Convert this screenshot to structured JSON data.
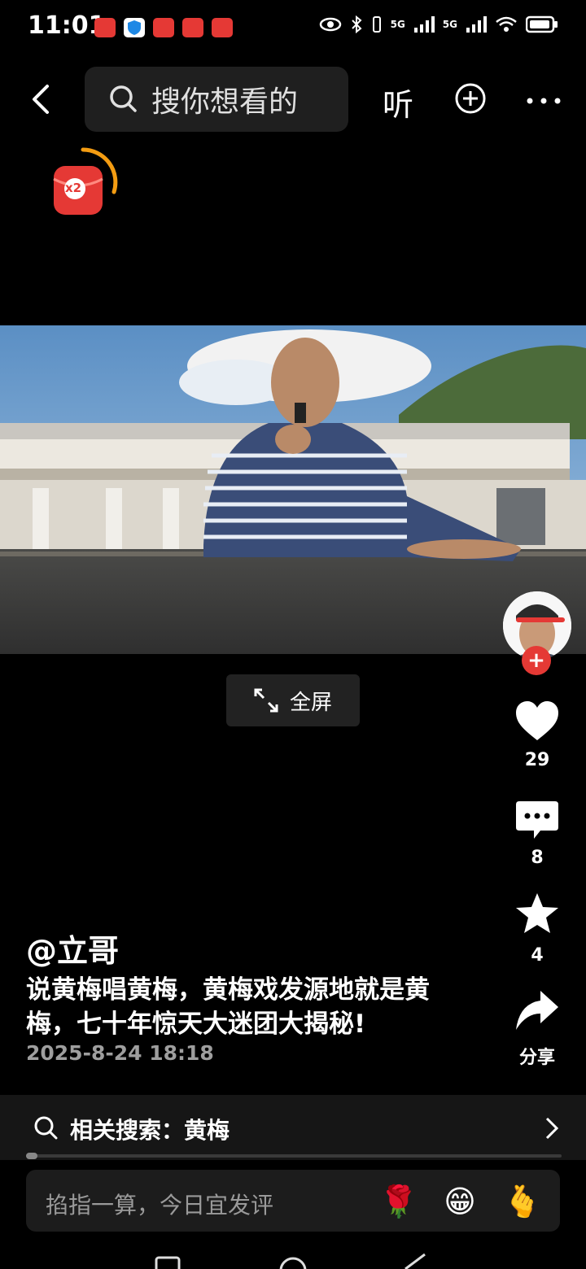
{
  "status_bar": {
    "time": "11:01",
    "net1": "5G",
    "net2": "5G"
  },
  "top_bar": {
    "search_placeholder": "搜你想看的",
    "listen_label": "听"
  },
  "red_packet": {
    "badge": "x2"
  },
  "fullscreen_label": "全屏",
  "actions": {
    "likes": "29",
    "comments": "8",
    "favorites": "4",
    "share_label": "分享"
  },
  "post": {
    "author": "@立哥",
    "caption": "说黄梅唱黄梅，黄梅戏发源地就是黄梅，七十年惊天大迷团大揭秘!",
    "date": "2025-8-24 18:18"
  },
  "related_search": {
    "label": "相关搜索：黄梅"
  },
  "comment_box": {
    "placeholder": "掐指一算，今日宜发评",
    "emojis": [
      "🌹",
      "😁",
      "🫰"
    ]
  },
  "colors": {
    "accent_red": "#e53935",
    "redpacket_orange": "#f39c12",
    "background": "#000000"
  }
}
